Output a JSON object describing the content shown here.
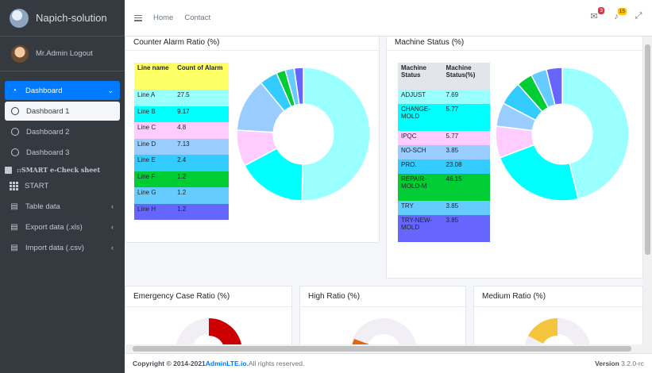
{
  "brand": {
    "name": "Napich-solution"
  },
  "user": {
    "name": "Mr.Admin Logout"
  },
  "sidebar": {
    "dashboard": "Dashboard",
    "sub_items": [
      "Dashboard 1",
      "Dashboard 2",
      "Dashboard 3"
    ],
    "section": "::SMART e-Check sheet",
    "start": "START",
    "table_data": "Table data",
    "export": "Export data (.xls)",
    "import": "Import data (.csv)"
  },
  "topbar": {
    "home": "Home",
    "contact": "Contact",
    "messages_badge": "3",
    "notif_badge": "15"
  },
  "cards": {
    "counter": {
      "title": "Counter Alarm Ratio (%)",
      "headers": [
        "Line name",
        "Count of Alarm"
      ],
      "rows": [
        {
          "name": "Line A",
          "value": "27.5",
          "color": "#99ffff"
        },
        {
          "name": "Line B",
          "value": "9.17",
          "color": "#00ffff"
        },
        {
          "name": "Line C",
          "value": "4.8",
          "color": "#ffccff"
        },
        {
          "name": "Line D",
          "value": "7.13",
          "color": "#99ccff"
        },
        {
          "name": "Line E",
          "value": "2.4",
          "color": "#33ccff"
        },
        {
          "name": "Line F",
          "value": "1.2",
          "color": "#00cc33"
        },
        {
          "name": "Line G",
          "value": "1.2",
          "color": "#66ccff"
        },
        {
          "name": "Line H",
          "value": "1.2",
          "color": "#6666ff"
        }
      ]
    },
    "machine": {
      "title": "Machine Status (%)",
      "headers": [
        "Machine Status",
        "Machine Status(%)"
      ],
      "rows": [
        {
          "name": "ADJUST",
          "value": "7.69",
          "color": "#99ffff"
        },
        {
          "name": "CHANGE-MOLD",
          "value": "5.77",
          "color": "#00ffff"
        },
        {
          "name": "IPQC",
          "value": "5.77",
          "color": "#ffccff"
        },
        {
          "name": "NO-SCH",
          "value": "3.85",
          "color": "#99ccff"
        },
        {
          "name": "PRO.",
          "value": "23.08",
          "color": "#33ccff"
        },
        {
          "name": "REPAIR-MOLD-M",
          "value": "46.15",
          "color": "#00cc33"
        },
        {
          "name": "TRY",
          "value": "3.85",
          "color": "#66ccff"
        },
        {
          "name": "TRY-NEW-MOLD",
          "value": "3.85",
          "color": "#6666ff"
        }
      ]
    },
    "emergency": {
      "title": "Emergency Case Ratio (%)"
    },
    "high": {
      "title": "High Ratio (%)"
    },
    "medium": {
      "title": "Medium Ratio (%)"
    }
  },
  "chart_data": [
    {
      "type": "pie",
      "title": "Counter Alarm Ratio (%)",
      "categories": [
        "Line A",
        "Line B",
        "Line C",
        "Line D",
        "Line E",
        "Line F",
        "Line G",
        "Line H"
      ],
      "values": [
        27.5,
        9.17,
        4.8,
        7.13,
        2.4,
        1.2,
        1.2,
        1.2
      ],
      "colors": [
        "#99ffff",
        "#00ffff",
        "#ffccff",
        "#99ccff",
        "#33ccff",
        "#00cc33",
        "#66ccff",
        "#6666ff"
      ]
    },
    {
      "type": "pie",
      "title": "Machine Status (%)",
      "categories": [
        "ADJUST",
        "CHANGE-MOLD",
        "IPQC",
        "NO-SCH",
        "PRO.",
        "REPAIR-MOLD-M",
        "TRY",
        "TRY-NEW-MOLD"
      ],
      "values": [
        46.15,
        23.08,
        7.69,
        5.77,
        5.77,
        3.85,
        3.85,
        3.85
      ],
      "colors": [
        "#99ffff",
        "#00ffff",
        "#ffccff",
        "#99ccff",
        "#33ccff",
        "#00cc33",
        "#66ccff",
        "#6666ff"
      ]
    }
  ],
  "footer": {
    "copyright": "Copyright © 2014-2021 ",
    "link": "AdminLTE.io.",
    "rights": " All rights reserved.",
    "version_label": "Version",
    "version": "3.2.0-rc"
  }
}
